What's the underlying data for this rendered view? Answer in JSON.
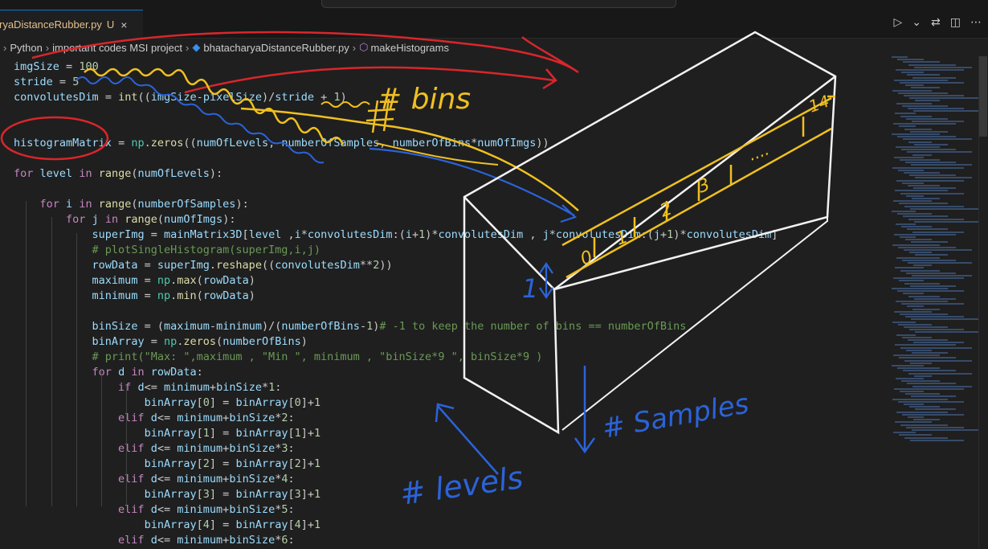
{
  "tab": {
    "filename": "ryaDistanceRubber.py",
    "modified": "U",
    "close": "×"
  },
  "tab_actions": [
    "▷",
    "⌄",
    "⇄",
    "◫",
    "⋯"
  ],
  "breadcrumb": [
    "Python",
    "important codes MSI project",
    "bhatacharyaDistanceRubber.py",
    "makeHistograms"
  ],
  "code": [
    "imgSize = 100",
    "stride = 5",
    "convolutesDim = int((imgSize-pixelSize)/stride + 1)",
    "",
    "",
    "histogramMatrix = np.zeros((numOfLevels, numberOfSamples, numberOfBins*numOfImgs))",
    "",
    "for level in range(numOfLevels):",
    "",
    "    for i in range(numberOfSamples):",
    "        for j in range(numOfImgs):",
    "            superImg = mainMatrix3D[level ,i*convolutesDim:(i+1)*convolutesDim , j*convolutesDim:(j+1)*convolutesDim]",
    "            # plotSingleHistogram(superImg,i,j)",
    "            rowData = superImg.reshape((convolutesDim**2))",
    "            maximum = np.max(rowData)",
    "            minimum = np.min(rowData)",
    "",
    "            binSize = (maximum-minimum)/(numberOfBins-1)# -1 to keep the number of bins == numberOfBins",
    "            binArray = np.zeros(numberOfBins)",
    "            # print(\"Max: \",maximum , \"Min \", minimum , \"binSize*9 \", binSize*9 )",
    "            for d in rowData:",
    "                if d<= minimum+binSize*1:",
    "                    binArray[0] = binArray[0]+1",
    "                elif d<= minimum+binSize*2:",
    "                    binArray[1] = binArray[1]+1",
    "                elif d<= minimum+binSize*3:",
    "                    binArray[2] = binArray[2]+1",
    "                elif d<= minimum+binSize*4:",
    "                    binArray[3] = binArray[3]+1",
    "                elif d<= minimum+binSize*5:",
    "                    binArray[4] = binArray[4]+1",
    "                elif d<= minimum+binSize*6:"
  ],
  "annotations": {
    "bins": "# bins",
    "samples": "# Samples",
    "levels": "# levels",
    "one": "1",
    "bin_labels": [
      "0",
      "1",
      "2",
      "3",
      "....",
      "14"
    ]
  },
  "colors": {
    "keyword": "#c586c0",
    "function": "#dcdcaa",
    "variable": "#9cdcfe",
    "number": "#b5cea8",
    "string": "#ce9178",
    "comment": "#6a9955",
    "ink_red": "#d9262b",
    "ink_yellow": "#f0c020",
    "ink_blue": "#2b63d9",
    "ink_white": "#f2f2f2"
  }
}
